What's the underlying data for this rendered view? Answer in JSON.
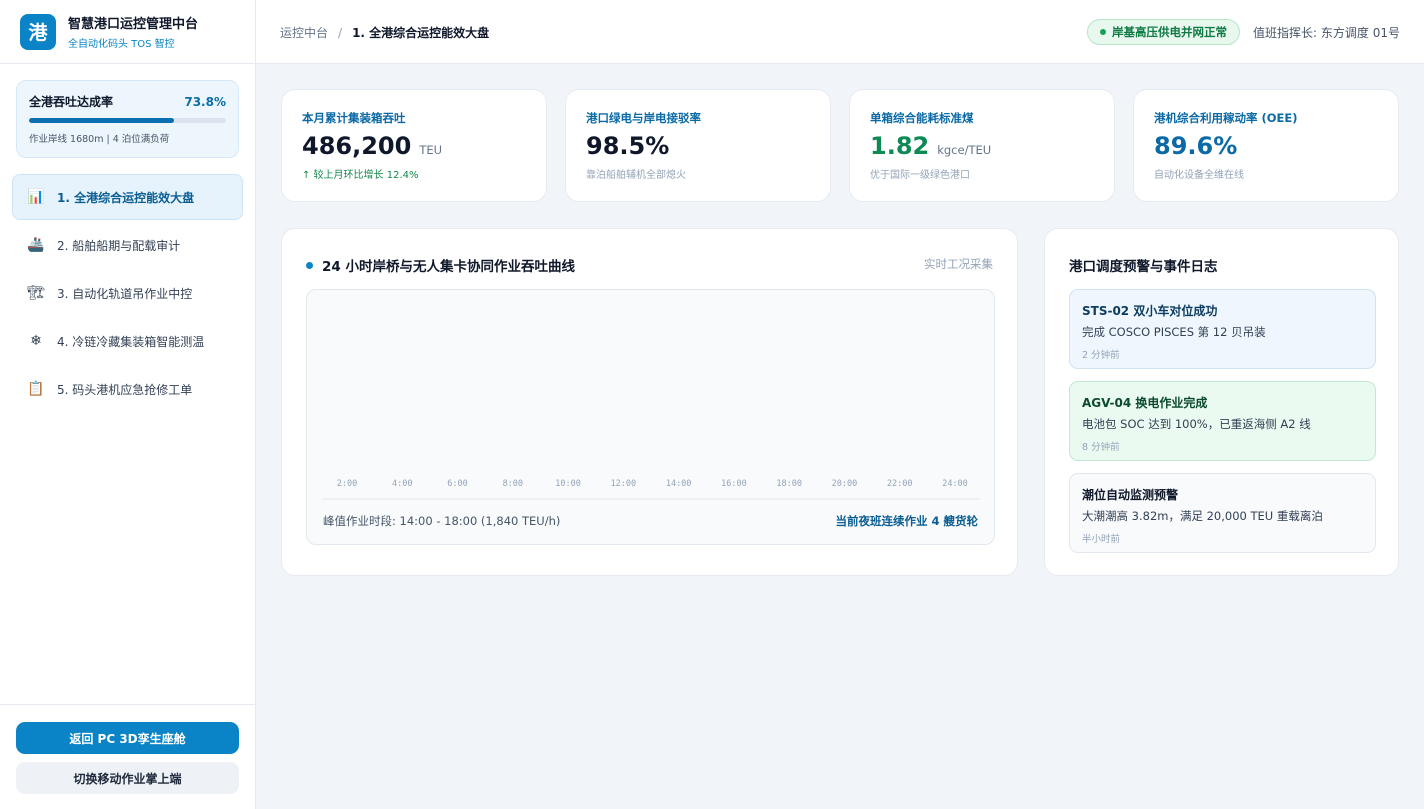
{
  "brand": {
    "logo": "港",
    "title": "智慧港口运控管理中台",
    "subtitle": "全自动化码头 TOS 智控"
  },
  "rate": {
    "label": "全港吞吐达成率",
    "value": "73.8%",
    "progress": 0.738,
    "note": "作业岸线 1680m | 4 泊位满负荷"
  },
  "nav": [
    {
      "label": "1. 全港综合运控能效大盘",
      "icon": "bar-chart-icon",
      "glyph": "📊",
      "active": true
    },
    {
      "label": "2. 船舶船期与配载审计",
      "icon": "ship-icon",
      "glyph": "🚢",
      "active": false
    },
    {
      "label": "3. 自动化轨道吊作业中控",
      "icon": "crane-icon",
      "glyph": "🏗",
      "active": false
    },
    {
      "label": "4. 冷链冷藏集装箱智能测温",
      "icon": "snowflake-icon",
      "glyph": "❄",
      "active": false
    },
    {
      "label": "5. 码头港机应急抢修工单",
      "icon": "clipboard-icon",
      "glyph": "📋",
      "active": false
    }
  ],
  "actions": {
    "primary": "返回 PC 3D孪生座舱",
    "secondary": "切换移动作业掌上端"
  },
  "header": {
    "breadcrumb_root": "运控中台",
    "breadcrumb_sep": "/",
    "breadcrumb_current": "1. 全港综合运控能效大盘",
    "status": "岸基高压供电并网正常",
    "duty": "值班指挥长: 东方调度 01号"
  },
  "kpis": [
    {
      "label": "本月累计集装箱吞吐",
      "value": "486,200",
      "unit": "TEU",
      "note": "↑ 较上月环比增长 12.4%",
      "value_color": "#0f172a"
    },
    {
      "label": "港口绿电与岸电接驳率",
      "value": "98.5%",
      "unit": "",
      "note": "靠泊船舶辅机全部熄火",
      "value_color": "#0f172a"
    },
    {
      "label": "单箱综合能耗标准煤",
      "value": "1.82",
      "unit": "kgce/TEU",
      "note": "优于国际一级绿色港口",
      "value_color": "#0e8a55"
    },
    {
      "label": "港机综合利用稼动率 (OEE)",
      "value": "89.6%",
      "unit": "",
      "note": "自动化设备全维在线",
      "value_color": "#0b6aa6"
    }
  ],
  "chart": {
    "title": "24 小时岸桥与无人集卡协同作业吞吐曲线",
    "tag": "实时工况采集",
    "foot_left": "峰值作业时段: 14:00 - 18:00 (1,840 TEU/h)",
    "foot_right": "当前夜班连续作业 4 艘货轮"
  },
  "chart_data": {
    "type": "line",
    "categories": [
      "2:00",
      "4:00",
      "6:00",
      "8:00",
      "10:00",
      "12:00",
      "14:00",
      "16:00",
      "18:00",
      "20:00",
      "22:00",
      "24:00"
    ],
    "series": [],
    "title": "24 小时岸桥与无人集卡协同作业吞吐曲线",
    "xlabel": "",
    "ylabel": "",
    "grid": false
  },
  "events": {
    "title": "港口调度预警与事件日志",
    "items": [
      {
        "title": "STS-02 双小车对位成功",
        "desc": "完成 COSCO PISCES 第 12 贝吊装",
        "time": "2 分钟前",
        "tone": "blue"
      },
      {
        "title": "AGV-04 换电作业完成",
        "desc": "电池包 SOC 达到 100%，已重返海侧 A2 线",
        "time": "8 分钟前",
        "tone": "green"
      },
      {
        "title": "潮位自动监测预警",
        "desc": "大潮潮高 3.82m，满足 20,000 TEU 重载离泊",
        "time": "半小时前",
        "tone": "gray"
      }
    ]
  },
  "colors": {
    "accent": "#0a84c6",
    "success": "#14a058",
    "bg": "#f1f5f9"
  }
}
